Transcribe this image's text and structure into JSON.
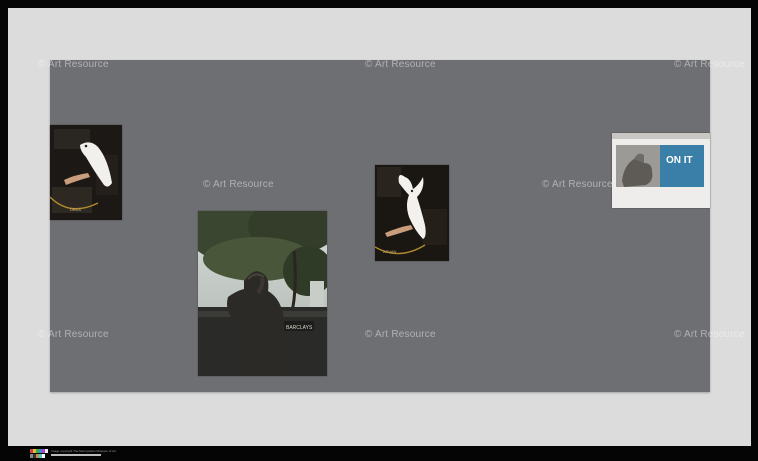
{
  "watermark": {
    "text": "© Art Resource",
    "color": "#ffffff"
  },
  "footer": {
    "credit": "Image copyright The Metropolitan Museum of Art"
  },
  "artworks": [
    {
      "name": "cockatoo-photo-left",
      "icon": "cockatoo-on-hand-photo"
    },
    {
      "name": "bronze-statue-photo",
      "icon": "statue-under-trees-photo"
    },
    {
      "name": "cockatoo-photo-center",
      "icon": "cockatoo-wings-up-photo"
    },
    {
      "name": "on-it-sign-photo",
      "icon": "hand-sign-photo",
      "sign_text": "ON IT",
      "sign_color": "#3a7fa8"
    }
  ],
  "colors": {
    "frame": "#050505",
    "mat": "#dcdcdc",
    "board": "#6e6f72"
  }
}
